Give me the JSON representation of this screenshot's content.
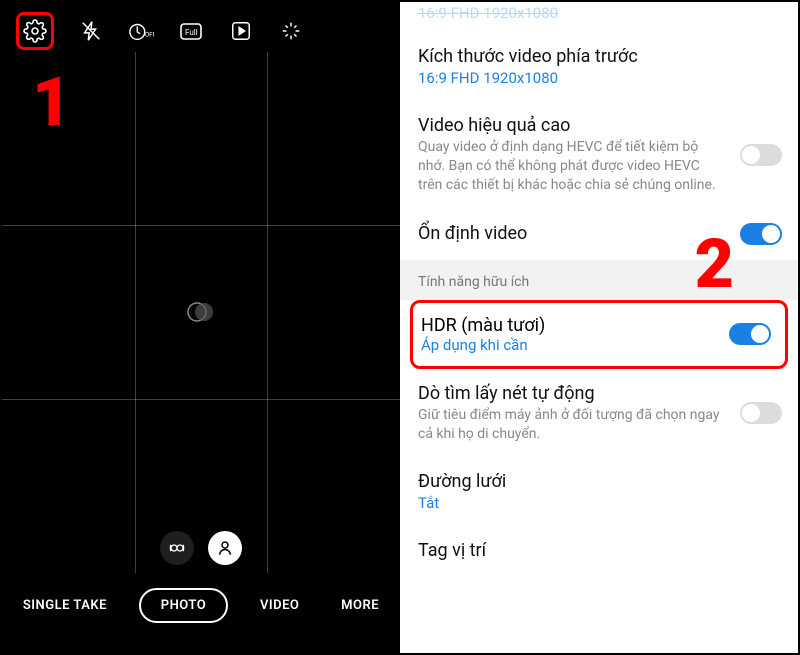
{
  "step1": "1",
  "step2": "2",
  "camera": {
    "modes": {
      "single_take": "SINGLE TAKE",
      "photo": "PHOTO",
      "video": "VIDEO",
      "more": "MORE"
    }
  },
  "settings": {
    "truncated_top": "16:9 FHD 1920x1080",
    "front_video": {
      "title": "Kích thước video phía trước",
      "sub": "16:9 FHD 1920x1080"
    },
    "hevc": {
      "title": "Video hiệu quả cao",
      "desc": "Quay video ở định dạng HEVC để tiết kiệm bộ nhớ. Bạn có thể không phát được video HEVC trên các thiết bị khác hoặc chia sẻ chúng online.",
      "on": false
    },
    "stabilize": {
      "title": "Ổn định video",
      "on": true
    },
    "section_useful": "Tính năng hữu ích",
    "hdr": {
      "title": "HDR (màu tươi)",
      "sub": "Áp dụng khi cần",
      "on": true
    },
    "autofocus": {
      "title": "Dò tìm lấy nét tự động",
      "desc": "Giữ tiêu điểm máy ảnh ở đối tượng đã chọn ngay cả khi họ di chuyển.",
      "on": false
    },
    "gridlines": {
      "title": "Đường lưới",
      "sub": "Tắt"
    },
    "geotag": {
      "title": "Tag vị trí"
    }
  }
}
